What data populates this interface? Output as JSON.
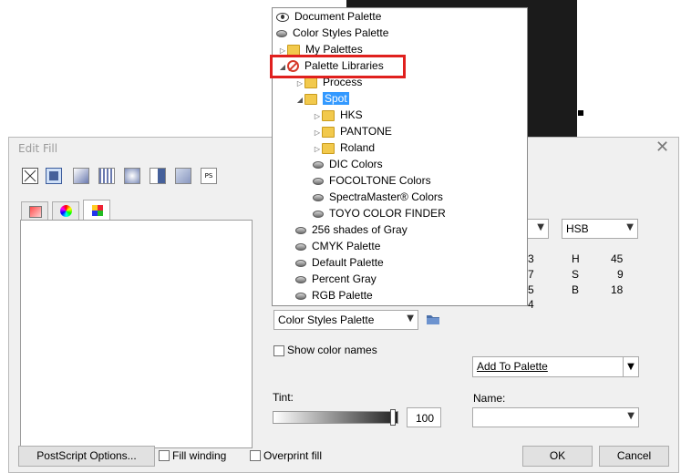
{
  "dialog": {
    "title": "Edit Fill",
    "close_glyph": "✕"
  },
  "tree": {
    "items": [
      {
        "label": "Document Palette",
        "icon": "eye-icon"
      },
      {
        "label": "Color Styles Palette",
        "icon": "palette-icon"
      },
      {
        "label": "My Palettes",
        "icon": "folder-icon"
      },
      {
        "label": "Palette Libraries",
        "icon": "no-entry-icon"
      },
      {
        "label": "Process",
        "icon": "folder-icon"
      },
      {
        "label": "Spot",
        "icon": "folder-icon"
      },
      {
        "label": "HKS",
        "icon": "folder-icon"
      },
      {
        "label": "PANTONE",
        "icon": "folder-icon"
      },
      {
        "label": "Roland",
        "icon": "folder-icon"
      },
      {
        "label": "DIC Colors",
        "icon": "palette-icon"
      },
      {
        "label": "FOCOLTONE Colors",
        "icon": "palette-icon"
      },
      {
        "label": "SpectraMaster® Colors",
        "icon": "palette-icon"
      },
      {
        "label": "TOYO COLOR FINDER",
        "icon": "palette-icon"
      },
      {
        "label": "256 shades of Gray",
        "icon": "palette-icon"
      },
      {
        "label": "CMYK Palette",
        "icon": "palette-icon"
      },
      {
        "label": "Default Palette",
        "icon": "palette-icon"
      },
      {
        "label": "Percent Gray",
        "icon": "palette-icon"
      },
      {
        "label": "RGB Palette",
        "icon": "palette-icon"
      }
    ],
    "highlight_color": "#e0201e",
    "selection_color": "#3399ff"
  },
  "palette_select": {
    "value": "Color Styles Palette"
  },
  "show_color_names": {
    "label": "Show color names"
  },
  "tint": {
    "label": "Tint:",
    "value": "100",
    "level_percent": 100
  },
  "color_model": {
    "value": "HSB"
  },
  "values": {
    "left_digits": [
      "3",
      "7",
      "5",
      "4"
    ],
    "hsb": [
      {
        "name": "H",
        "value": "45"
      },
      {
        "name": "S",
        "value": "9"
      },
      {
        "name": "B",
        "value": "18"
      }
    ]
  },
  "add_to_palette": {
    "label": "Add To Palette"
  },
  "name_field": {
    "label": "Name:",
    "value": ""
  },
  "footer": {
    "postscript": "PostScript Options...",
    "fill_winding": "Fill winding",
    "overprint_fill": "Overprint fill",
    "ok": "OK",
    "cancel": "Cancel"
  }
}
